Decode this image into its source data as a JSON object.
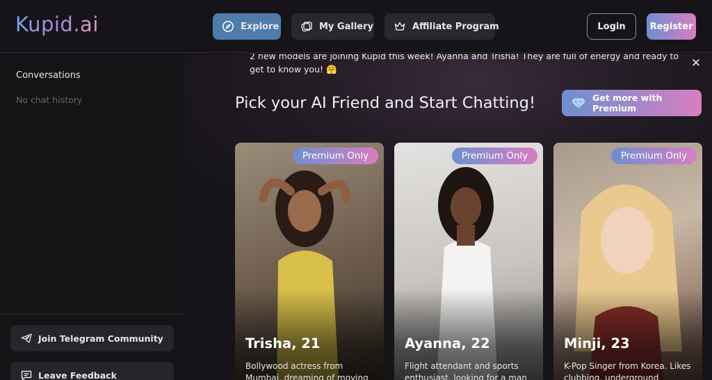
{
  "header": {
    "logo": "Kupid.ai",
    "nav": [
      {
        "label": "Explore",
        "icon": "compass-icon",
        "active": true
      },
      {
        "label": "My Gallery",
        "icon": "gallery-icon",
        "active": false
      },
      {
        "label": "Affiliate Program",
        "icon": "crown-icon",
        "active": false
      }
    ],
    "login_label": "Login",
    "register_label": "Register"
  },
  "sidebar": {
    "title": "Conversations",
    "empty_text": "No chat history",
    "telegram_label": "Join Telegram Community",
    "feedback_label": "Leave Feedback"
  },
  "main": {
    "announcement": "2 new models are joining Kupid this week! Ayanna and Trisha! They are full of energy and ready to get to know you! 🤗",
    "close_symbol": "✕",
    "headline": "Pick your AI Friend and Start Chatting!",
    "premium_label": "Get more with Premium",
    "cards": [
      {
        "badge": "Premium Only",
        "name": "Trisha, 21",
        "description": "Bollywood actress from Mumbai, dreaming of moving"
      },
      {
        "badge": "Premium Only",
        "name": "Ayanna, 22",
        "description": "Flight attendant and sports enthusiast, looking for a man"
      },
      {
        "badge": "Premium Only",
        "name": "Minji, 23",
        "description": "K-Pop Singer from Korea. Likes clubbing, underground"
      }
    ]
  },
  "colors": {
    "accent_blue": "#4f7cab",
    "gradient_start": "#6d8fd0",
    "gradient_end": "#d67fc0",
    "background": "#141316"
  }
}
